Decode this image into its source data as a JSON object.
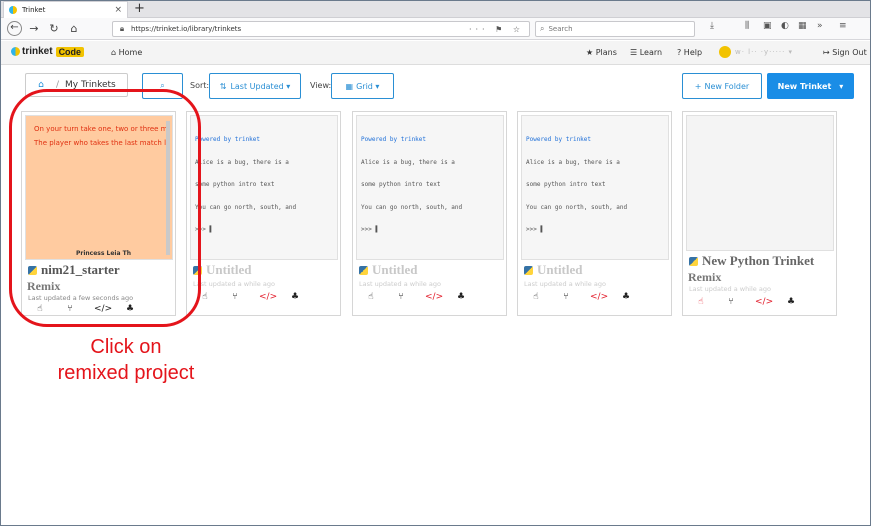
{
  "browser": {
    "tab_title": "Trinket",
    "tab_close": "×",
    "new_tab": "+",
    "url": "https://trinket.io/library/trinkets",
    "search_placeholder": "Search",
    "nav": {
      "back": "←",
      "forward": "→",
      "reload": "↻",
      "home": "⌂"
    },
    "url_actions": "··· ⚑ ☆",
    "search_icon": "⌕",
    "ext_icons": [
      "⤓",
      "⫼",
      "▣",
      "◐",
      "▦",
      "»",
      "≡"
    ]
  },
  "site": {
    "logo_text": "trinket",
    "logo_badge": "Code",
    "home": "Home",
    "links": [
      "Plans",
      "Learn",
      "Help"
    ],
    "link_icons": [
      "★",
      "☰",
      "?"
    ],
    "sign_out": "Sign Out",
    "sign_out_icon": "↦",
    "home_icon": "⌂",
    "username": "w· l·· ·y····· ▾"
  },
  "toolbar": {
    "breadcrumb_home_icon": "⌂",
    "breadcrumb_sep": "/",
    "breadcrumb": "My Trinkets",
    "search_icon": "⌕",
    "sort_label": "Sort:",
    "sort_value": "Last Updated ▾",
    "sort_icon": "⇅",
    "view_label": "View:",
    "view_value": "Grid ▾",
    "view_icon": "▦",
    "new_folder": "New Folder",
    "new_folder_icon": "+",
    "new_trinket": "New Trinket",
    "new_trinket_caret": "▾"
  },
  "cards": [
    {
      "preview_lines": [
        "On your turn take one, two or three m",
        "The player who takes the last match l"
      ],
      "preview_bottom": "Princess Leia       Th",
      "title": "nim21_starter",
      "subtitle": "Remix",
      "meta": "Last updated a few seconds ago"
    },
    {
      "powered": "Powered by trinket",
      "preview_lines": [
        "Alice is a bug, there is a",
        "some python intro text",
        "You can go north, south, and",
        ">>> ▌"
      ],
      "title": "Untitled",
      "meta": "Last updated a while ago"
    },
    {
      "powered": "Powered by trinket",
      "preview_lines": [
        "Alice is a bug, there is a",
        "some python intro text",
        "You can go north, south, and",
        ">>> ▌"
      ],
      "title": "Untitled",
      "meta": "Last updated a while ago"
    },
    {
      "powered": "Powered by trinket",
      "preview_lines": [
        "Alice is a bug, there is a",
        "some python intro text",
        "You can go north, south, and",
        ">>> ▌"
      ],
      "title": "Untitled",
      "meta": "Last updated a while ago"
    },
    {
      "title": "New Python Trinket",
      "subtitle": "Remix",
      "meta": "Last updated a while ago"
    }
  ],
  "card_icons": {
    "open": "☝",
    "fork": "⑂",
    "embed": "</>",
    "share": "♣"
  },
  "annotation": {
    "line1": "Click on",
    "line2": "remixed project",
    "color": "#e4141b"
  }
}
